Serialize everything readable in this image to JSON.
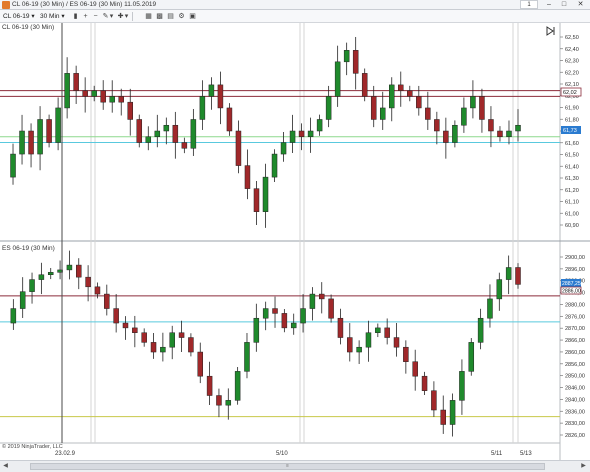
{
  "window": {
    "title": "CL 06-19 (30 Min) / ES 06-19 (30 Min)  11.05.2019",
    "page_label": "1"
  },
  "toolbar": {
    "instrument": "CL 06-19",
    "interval": "30 Min"
  },
  "panels": [
    {
      "label": "CL 06-19 (30 Min)",
      "y_ticks": [
        "62,50",
        "62,40",
        "62,30",
        "62,20",
        "62,10",
        "62,00",
        "61,90",
        "61,80",
        "61,70",
        "61,60",
        "61,50",
        "61,40",
        "61,30",
        "61,20",
        "61,10",
        "61,00",
        "60,90"
      ],
      "price_tag": "62,02",
      "price_tag_2": "61,73"
    },
    {
      "label": "ES 06-19 (30 Min)",
      "y_ticks": [
        "2900,00",
        "2896,00",
        "2890,00",
        "2886,00",
        "2880,00",
        "2876,00",
        "2870,00",
        "2866,00",
        "2860,00",
        "2856,00",
        "2850,00",
        "2846,00",
        "2840,00",
        "2836,00",
        "2830,00",
        "2826,00"
      ],
      "price_tag": "2887,25",
      "price_tag_2": "2886,00"
    }
  ],
  "x_axis": {
    "labels": [
      "23.02.9",
      "5/10",
      "5/11",
      "5/13"
    ]
  },
  "copyright": "© 2019 NinjaTrader, LLC",
  "colors": {
    "up": "#1f8a2c",
    "down": "#a0282a",
    "price_tag": "#2a7bd0",
    "maroon_line": "#8b2b3a",
    "cyan_line": "#59c9de",
    "green_line": "#8ed98e",
    "yellow_line": "#c8c84a"
  },
  "chart_data": [
    {
      "type": "candlestick",
      "instrument": "CL 06-19 (30 Min)",
      "y_axis": {
        "min": 60.85,
        "max": 62.55
      },
      "horizontal_lines": [
        62.05,
        62.0,
        61.65,
        61.6
      ],
      "closes": [
        61.3,
        61.5,
        61.7,
        61.5,
        61.8,
        61.6,
        61.9,
        62.2,
        62.05,
        62.0,
        62.05,
        61.95,
        62.0,
        61.95,
        61.8,
        61.6,
        61.65,
        61.7,
        61.75,
        61.6,
        61.55,
        61.8,
        62.0,
        62.1,
        61.9,
        61.7,
        61.4,
        61.2,
        61.0,
        61.3,
        61.5,
        61.6,
        61.7,
        61.65,
        61.7,
        61.8,
        62.0,
        62.3,
        62.4,
        62.2,
        62.0,
        61.8,
        61.9,
        62.1,
        62.05,
        62.0,
        61.9,
        61.8,
        61.7,
        61.6,
        61.75,
        61.9,
        62.0,
        61.8,
        61.7,
        61.65,
        61.7,
        61.75
      ]
    },
    {
      "type": "candlestick",
      "instrument": "ES 06-19 (30 Min)",
      "y_axis": {
        "min": 2824,
        "max": 2901
      },
      "horizontal_lines": [
        2883.25,
        2872.5,
        2833.25
      ],
      "closes": [
        2872,
        2878,
        2885,
        2890,
        2892,
        2893,
        2894,
        2896,
        2891,
        2887,
        2884,
        2878,
        2872,
        2870,
        2868,
        2864,
        2860,
        2862,
        2868,
        2866,
        2860,
        2850,
        2842,
        2838,
        2840,
        2852,
        2864,
        2874,
        2878,
        2876,
        2870,
        2872,
        2878,
        2884,
        2882,
        2874,
        2866,
        2860,
        2862,
        2868,
        2870,
        2866,
        2862,
        2856,
        2850,
        2844,
        2836,
        2830,
        2840,
        2852,
        2864,
        2874,
        2882,
        2890,
        2895,
        2888
      ]
    }
  ]
}
